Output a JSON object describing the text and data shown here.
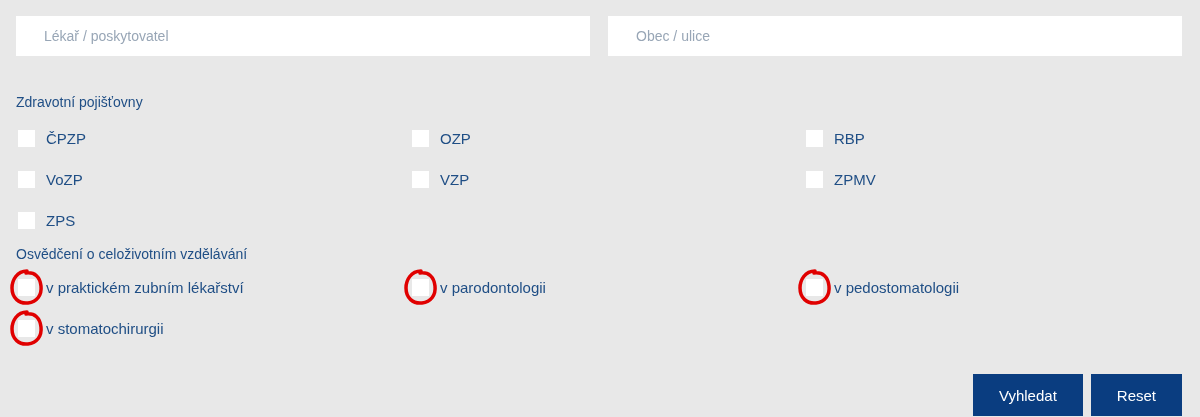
{
  "search_fields": [
    {
      "placeholder": "Lékař / poskytovatel"
    },
    {
      "placeholder": "Obec / ulice"
    }
  ],
  "insurers": {
    "heading": "Zdravotní pojišťovny",
    "options": [
      {
        "label": "ČPZP",
        "checked": false,
        "circled": false
      },
      {
        "label": "OZP",
        "checked": false,
        "circled": false
      },
      {
        "label": "RBP",
        "checked": false,
        "circled": false
      },
      {
        "label": "VoZP",
        "checked": false,
        "circled": false
      },
      {
        "label": "VZP",
        "checked": false,
        "circled": false
      },
      {
        "label": "ZPMV",
        "checked": false,
        "circled": false
      },
      {
        "label": "ZPS",
        "checked": false,
        "circled": false
      }
    ]
  },
  "certificates": {
    "heading": "Osvědčení o celoživotním vzdělávání",
    "options": [
      {
        "label": "v praktickém zubním lékařství",
        "checked": false,
        "circled": true
      },
      {
        "label": "v parodontologii",
        "checked": false,
        "circled": true
      },
      {
        "label": "v pedostomatologii",
        "checked": false,
        "circled": true
      },
      {
        "label": "v stomatochirurgii",
        "checked": false,
        "circled": true
      }
    ]
  },
  "buttons": [
    "Vyhledat",
    "Reset"
  ]
}
